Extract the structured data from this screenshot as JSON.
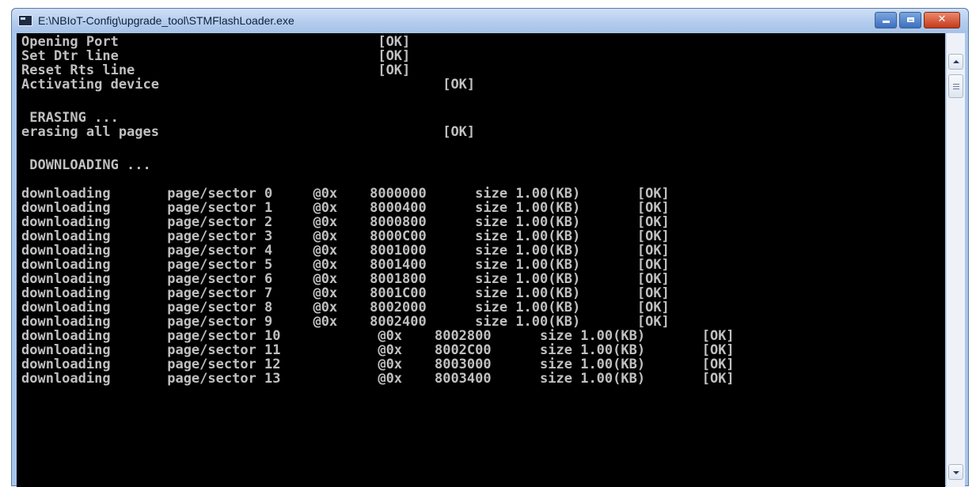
{
  "window": {
    "title": "E:\\NBIoT-Config\\upgrade_tool\\STMFlashLoader.exe"
  },
  "console_lines": [
    "Opening Port                                [OK]",
    "Set Dtr line                                [OK]",
    "Reset Rts line                              [OK]",
    "Activating device                                   [OK]",
    "",
    " ERASING ...",
    "erasing all pages                                   [OK]",
    "",
    " DOWNLOADING ...",
    "",
    "downloading       page/sector 0     @0x    8000000      size 1.00(KB)       [OK]",
    "downloading       page/sector 1     @0x    8000400      size 1.00(KB)       [OK]",
    "downloading       page/sector 2     @0x    8000800      size 1.00(KB)       [OK]",
    "downloading       page/sector 3     @0x    8000C00      size 1.00(KB)       [OK]",
    "downloading       page/sector 4     @0x    8001000      size 1.00(KB)       [OK]",
    "downloading       page/sector 5     @0x    8001400      size 1.00(KB)       [OK]",
    "downloading       page/sector 6     @0x    8001800      size 1.00(KB)       [OK]",
    "downloading       page/sector 7     @0x    8001C00      size 1.00(KB)       [OK]",
    "downloading       page/sector 8     @0x    8002000      size 1.00(KB)       [OK]",
    "downloading       page/sector 9     @0x    8002400      size 1.00(KB)       [OK]",
    "downloading       page/sector 10            @0x    8002800      size 1.00(KB)       [OK]",
    "downloading       page/sector 11            @0x    8002C00      size 1.00(KB)       [OK]",
    "downloading       page/sector 12            @0x    8003000      size 1.00(KB)       [OK]",
    "downloading       page/sector 13            @0x    8003400      size 1.00(KB)       [OK]"
  ],
  "icons": {
    "app": "console-app-icon",
    "minimize": "minimize-icon",
    "maximize": "maximize-icon",
    "close": "close-icon",
    "scroll_up": "scroll-up-icon",
    "scroll_down": "scroll-down-icon"
  },
  "colors": {
    "console_background": "#000000",
    "console_text": "#c0c0c0",
    "close_button": "#c5391b"
  }
}
